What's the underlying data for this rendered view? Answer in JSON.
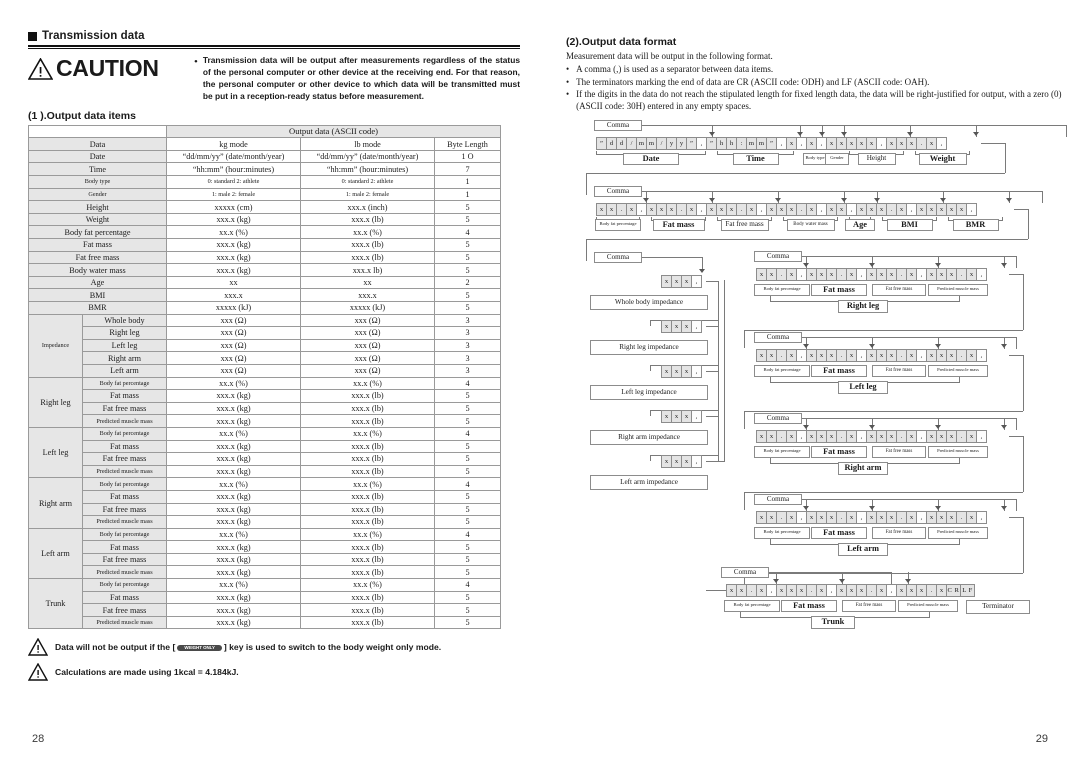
{
  "left_page": {
    "section_title": "Transmission data",
    "caution": {
      "word": "CAUTION",
      "bullet": "•",
      "text": "Transmission data will be output after measurements regardless of the status of the personal computer or other device at the receiving end.  For that reason, the personal computer or other device to which data will be transmitted must be put in a reception-ready status before measurement."
    },
    "subsection_title": "(1 ).Output data items",
    "table": {
      "header_span": "Output data (ASCII code)",
      "columns": [
        "Data",
        "kg mode",
        "lb mode",
        "Byte Length"
      ],
      "rows": [
        {
          "label": "Date",
          "kg": "“dd/mm/yy” (date/month/year)",
          "lb": "“dd/mm/yy” (date/month/year)",
          "bytes": "1 O"
        },
        {
          "label": "Time",
          "kg": "“hh:mm” (hour:minutes)",
          "lb": "“hh:mm” (hour:minutes)",
          "bytes": "7"
        },
        {
          "label": "Body type",
          "kg": "0: standard  2: athlete",
          "lb": "0: standard  2: athlete",
          "bytes": "1",
          "small": true
        },
        {
          "label": "Gender",
          "kg": "1: male  2: female",
          "lb": "1: male  2: female",
          "bytes": "1",
          "small": true
        },
        {
          "label": "Height",
          "kg": "xxxxx (cm)",
          "lb": "xxx.x (inch)",
          "bytes": "5"
        },
        {
          "label": "Weight",
          "kg": "xxx.x (kg)",
          "lb": "xxx.x (lb)",
          "bytes": "5"
        },
        {
          "label": "Body fat percentage",
          "kg": "xx.x (%)",
          "lb": "xx.x (%)",
          "bytes": "4"
        },
        {
          "label": "Fat mass",
          "kg": "xxx.x (kg)",
          "lb": "xxx.x (lb)",
          "bytes": "5"
        },
        {
          "label": "Fat free mass",
          "kg": "xxx.x (kg)",
          "lb": "xxx.x (lb)",
          "bytes": "5"
        },
        {
          "label": "Body water mass",
          "kg": "xxx.x (kg)",
          "lb": "xxx.x lb)",
          "bytes": "5"
        },
        {
          "label": "Age",
          "kg": "xx",
          "lb": "xx",
          "bytes": "2"
        },
        {
          "label": "BMI",
          "kg": "xxx.x",
          "lb": "xxx.x",
          "bytes": "5"
        },
        {
          "label": "BMR",
          "kg": "xxxxx (kJ)",
          "lb": "xxxxx (kJ)",
          "bytes": "5"
        }
      ],
      "groups": [
        {
          "group": "Impedance",
          "rows": [
            {
              "label": "Whole body",
              "kg": "xxx (Ω)",
              "lb": "xxx (Ω)",
              "bytes": "3"
            },
            {
              "label": "Right leg",
              "kg": "xxx (Ω)",
              "lb": "xxx (Ω)",
              "bytes": "3"
            },
            {
              "label": "Left leg",
              "kg": "xxx (Ω)",
              "lb": "xxx (Ω)",
              "bytes": "3"
            },
            {
              "label": "Right arm",
              "kg": "xxx (Ω)",
              "lb": "xxx (Ω)",
              "bytes": "3"
            },
            {
              "label": "Left arm",
              "kg": "xxx (Ω)",
              "lb": "xxx (Ω)",
              "bytes": "3"
            }
          ]
        },
        {
          "group": "Right leg",
          "rows": [
            {
              "label": "Body fat percentage",
              "small": true,
              "kg": "xx.x (%)",
              "lb": "xx.x (%)",
              "bytes": "4"
            },
            {
              "label": "Fat mass",
              "kg": "xxx.x (kg)",
              "lb": "xxx.x (lb)",
              "bytes": "5"
            },
            {
              "label": "Fat free mass",
              "kg": "xxx.x (kg)",
              "lb": "xxx.x (lb)",
              "bytes": "5"
            },
            {
              "label": "Predicted muscle mass",
              "small": true,
              "kg": "xxx.x (kg)",
              "lb": "xxx.x (lb)",
              "bytes": "5"
            }
          ]
        },
        {
          "group": "Left leg",
          "rows": [
            {
              "label": "Body fat percentage",
              "small": true,
              "kg": "xx.x (%)",
              "lb": "xx.x (%)",
              "bytes": "4"
            },
            {
              "label": "Fat mass",
              "kg": "xxx.x (kg)",
              "lb": "xxx.x (lb)",
              "bytes": "5"
            },
            {
              "label": "Fat free mass",
              "kg": "xxx.x (kg)",
              "lb": "xxx.x (lb)",
              "bytes": "5"
            },
            {
              "label": "Predicted muscle mass",
              "small": true,
              "kg": "xxx.x (kg)",
              "lb": "xxx.x (lb)",
              "bytes": "5"
            }
          ]
        },
        {
          "group": "Right arm",
          "rows": [
            {
              "label": "Body fat percentage",
              "small": true,
              "kg": "xx.x (%)",
              "lb": "xx.x (%)",
              "bytes": "4"
            },
            {
              "label": "Fat mass",
              "kg": "xxx.x (kg)",
              "lb": "xxx.x (lb)",
              "bytes": "5"
            },
            {
              "label": "Fat free mass",
              "kg": "xxx.x (kg)",
              "lb": "xxx.x (lb)",
              "bytes": "5"
            },
            {
              "label": "Predicted muscle mass",
              "small": true,
              "kg": "xxx.x (kg)",
              "lb": "xxx.x (lb)",
              "bytes": "5"
            }
          ]
        },
        {
          "group": "Left arm",
          "rows": [
            {
              "label": "Body fat percentage",
              "small": true,
              "kg": "xx.x (%)",
              "lb": "xx.x (%)",
              "bytes": "4"
            },
            {
              "label": "Fat mass",
              "kg": "xxx.x (kg)",
              "lb": "xxx.x (lb)",
              "bytes": "5"
            },
            {
              "label": "Fat free mass",
              "kg": "xxx.x (kg)",
              "lb": "xxx.x (lb)",
              "bytes": "5"
            },
            {
              "label": "Predicted muscle mass",
              "small": true,
              "kg": "xxx.x (kg)",
              "lb": "xxx.x (lb)",
              "bytes": "5"
            }
          ]
        },
        {
          "group": "Trunk",
          "rows": [
            {
              "label": "Body fat percentage",
              "small": true,
              "kg": "xx.x (%)",
              "lb": "xx.x (%)",
              "bytes": "4"
            },
            {
              "label": "Fat mass",
              "kg": "xxx.x (kg)",
              "lb": "xxx.x (lb)",
              "bytes": "5"
            },
            {
              "label": "Fat free mass",
              "kg": "xxx.x (kg)",
              "lb": "xxx.x (lb)",
              "bytes": "5"
            },
            {
              "label": "Predicted muscle mass",
              "small": true,
              "kg": "xxx.x (kg)",
              "lb": "xxx.x (lb)",
              "bytes": "5"
            }
          ]
        }
      ]
    },
    "warnings": [
      {
        "pre": "Data will not be output if the [",
        "key": "WEIGHT ONLY",
        "post": "] key is used to switch to the body weight only mode."
      },
      {
        "pre": "Calculations are made using 1kcal = 4.184kJ.",
        "key": "",
        "post": ""
      }
    ],
    "page_number": "28"
  },
  "right_page": {
    "title": "(2).Output data format",
    "lead": "Measurement data will be output in the following format.",
    "bullets": [
      "A comma (,) is used as a separator between data items.",
      "The terminators marking the end of data are CR (ASCII code: ODH) and LF (ASCII code: OAH).",
      "If the digits in the data do not reach the stipulated length for fixed length data, the data will be right-justified for output, with a zero (0) (ASCII code: 30H) entered in any empty spaces."
    ],
    "comma_label": "Comma",
    "rows": {
      "row1": {
        "cells": [
          "”",
          "d",
          "d",
          "/",
          "m",
          "m",
          "/",
          "y",
          "y",
          "”",
          ",",
          "”",
          "h",
          "h",
          ":",
          "m",
          "m",
          "”",
          ",",
          "x",
          ",",
          "x",
          ",",
          "x",
          "x",
          "x",
          "x",
          "x",
          ",",
          "x",
          "x",
          "x",
          ".",
          "x",
          ","
        ],
        "labels": [
          "Date",
          "Time",
          "Body type",
          "Gender",
          "Height",
          "Weight"
        ]
      },
      "row2": {
        "cells": [
          "x",
          "x",
          ".",
          "x",
          ",",
          "x",
          "x",
          "x",
          ".",
          "x",
          ",",
          "x",
          "x",
          "x",
          ".",
          "x",
          ",",
          "x",
          "x",
          "x",
          ".",
          "x",
          ",",
          "x",
          "x",
          ",",
          "x",
          "x",
          "x",
          ".",
          "x",
          ",",
          "x",
          "x",
          "x",
          "x",
          "x",
          ","
        ],
        "labels": [
          "Body fat percentage",
          "Fat mass",
          "Fat free mass",
          "Body water mass",
          "Age",
          "BMI",
          "BMR"
        ]
      },
      "impedance": {
        "cells": [
          "x",
          "x",
          "x",
          ","
        ],
        "labels": [
          "Whole body impedance",
          "Right leg impedance",
          "Left leg impedance",
          "Right arm impedance",
          "Left arm impedance"
        ]
      },
      "segment": {
        "cells": [
          "x",
          "x",
          ".",
          "x",
          ",",
          "x",
          "x",
          "x",
          ".",
          "x",
          ",",
          "x",
          "x",
          "x",
          ".",
          "x",
          ",",
          "x",
          "x",
          "x",
          ".",
          "x",
          ","
        ],
        "labels": [
          "Body fat percentage",
          "Fat mass",
          "Fat free mass",
          "Predicted muscle mass"
        ],
        "groups": [
          "Right leg",
          "Left leg",
          "Right arm",
          "Left arm"
        ]
      },
      "trunk": {
        "cells": [
          "x",
          "x",
          ".",
          "x",
          ",",
          "x",
          "x",
          "x",
          ".",
          "x",
          ",",
          "x",
          "x",
          "x",
          ".",
          "x",
          ",",
          "x",
          "x",
          "x",
          ".",
          "x"
        ],
        "terminator_cells": [
          "C R",
          "L F"
        ],
        "labels": [
          "Body fat percentage",
          "Fat mass",
          "Fat free mass",
          "Predicted muscle mass"
        ],
        "group": "Trunk",
        "terminator_label": "Terminator"
      }
    },
    "page_number": "29"
  }
}
